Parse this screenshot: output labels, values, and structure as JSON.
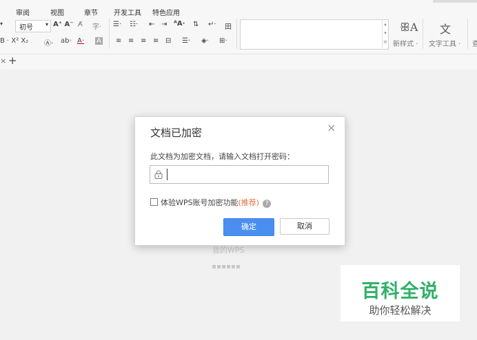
{
  "menubar": {
    "tabs": [
      "审阅",
      "视图",
      "章节",
      "开发工具",
      "特色应用"
    ]
  },
  "ribbon": {
    "font_size_value": "初号",
    "font_size_arrow": "▾",
    "row1_left": "A⁺ A⁻",
    "row2_left": "B · X² X₂",
    "new_style_label": "新样式 ·",
    "text_tools_label": "文字工具 ·",
    "cut_label": "查"
  },
  "tabrow": {
    "close_glyph": "×",
    "add_glyph": "+"
  },
  "background": {
    "ghost_text": "我的WPS"
  },
  "dialog": {
    "title": "文档已加密",
    "close_glyph": "×",
    "prompt": "此文档为加密文档，请输入文档打开密码：",
    "password_value": "",
    "checkbox_label": "体验WPS账号加密功能",
    "recommend_label": "(推荐)",
    "help_glyph": "?",
    "ok_label": "确定",
    "cancel_label": "取消"
  },
  "watermark": {
    "title": "百科全说",
    "subtitle": "助你轻松解决"
  },
  "colors": {
    "primary_button": "#4a8ff0",
    "recommend": "#e8703a",
    "watermark_green": "#2fb067"
  }
}
